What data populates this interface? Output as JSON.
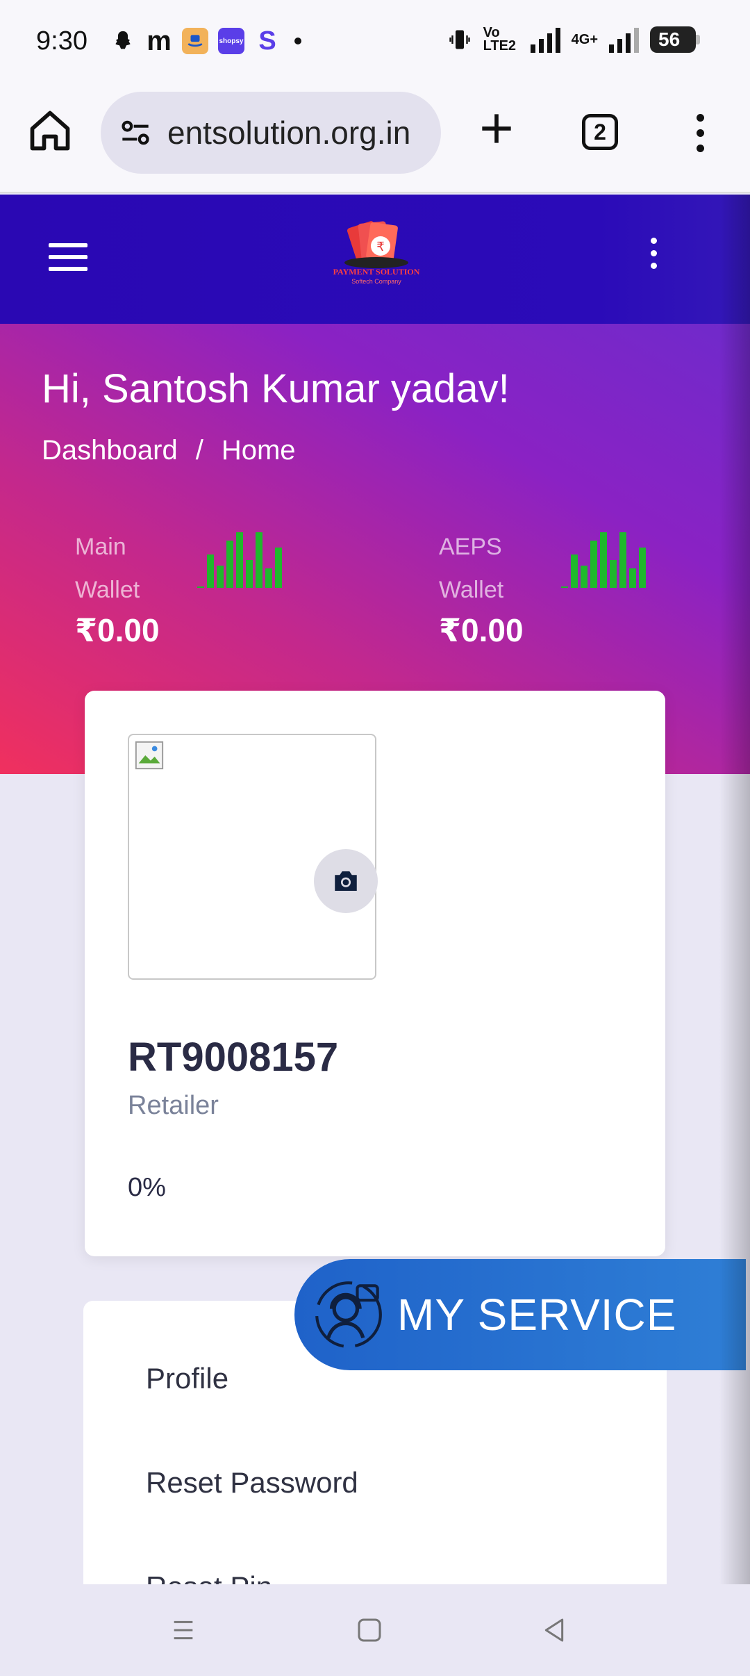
{
  "status_bar": {
    "time": "9:30",
    "app_icons": [
      "snapchat-icon",
      "gmail-icon",
      "amazon-icon",
      "shopsy-icon",
      "s-app-icon"
    ],
    "network": "Vo LTE2",
    "network2": "4G+",
    "battery": "56"
  },
  "browser": {
    "url": "entsolution.org.in",
    "tab_count": "2"
  },
  "header": {
    "logo_text": "PAYMENT SOLUTION",
    "logo_subtext": "Softech Company"
  },
  "hero": {
    "greeting": "Hi, Santosh Kumar yadav!",
    "breadcrumb": [
      "Dashboard",
      "/",
      "Home"
    ],
    "wallets": [
      {
        "label_line1": "Main",
        "label_line2": "Wallet",
        "value": "₹0.00"
      },
      {
        "label_line1": "AEPS",
        "label_line2": "Wallet",
        "value": "₹0.00"
      }
    ],
    "sparkline_color": "#1fb82c"
  },
  "profile": {
    "user_id": "RT9008157",
    "role": "Retailer",
    "percent": "0%"
  },
  "menu": {
    "items": [
      "Profile",
      "Reset Password",
      "Reset Pin"
    ]
  },
  "my_service": {
    "label": "MY SERVICE"
  },
  "colors": {
    "header_bg": "#2a08b3",
    "accent_blue": "#2f7fd6"
  }
}
